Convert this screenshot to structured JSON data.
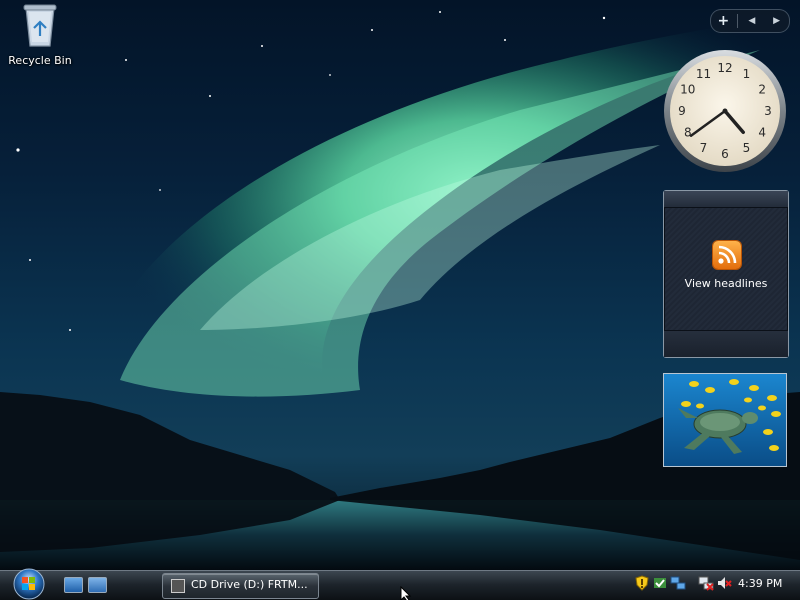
{
  "desktop": {
    "icons": [
      {
        "label": "Recycle Bin",
        "icon": "recycle-bin-icon"
      }
    ]
  },
  "sidebar": {
    "controls": {
      "add": "+",
      "prev": "◀",
      "next": "▶"
    },
    "clock": {
      "hour": 4,
      "minute": 39,
      "numbers": [
        "12",
        "1",
        "2",
        "3",
        "4",
        "5",
        "6",
        "7",
        "8",
        "9",
        "10",
        "11"
      ]
    },
    "feed": {
      "icon": "rss-icon",
      "text": "View headlines"
    },
    "slideshow": {
      "image": "sea-turtle-fish-photo"
    }
  },
  "taskbar": {
    "start_icon": "windows-orb-icon",
    "quick_launch": [
      "show-desktop-icon",
      "switch-windows-icon"
    ],
    "task_button": {
      "label": "CD Drive (D:) FRTM...",
      "icon": "cd-drive-icon"
    },
    "tray_icons": [
      "security-shield-icon",
      "windows-defender-icon",
      "network-icon",
      "network-disconnected-icon",
      "volume-muted-icon"
    ],
    "time": "4:39 PM"
  },
  "colors": {
    "aurora": "#5fe0a6",
    "taskbar": "#1d242b",
    "rss": "#f28a1e"
  }
}
